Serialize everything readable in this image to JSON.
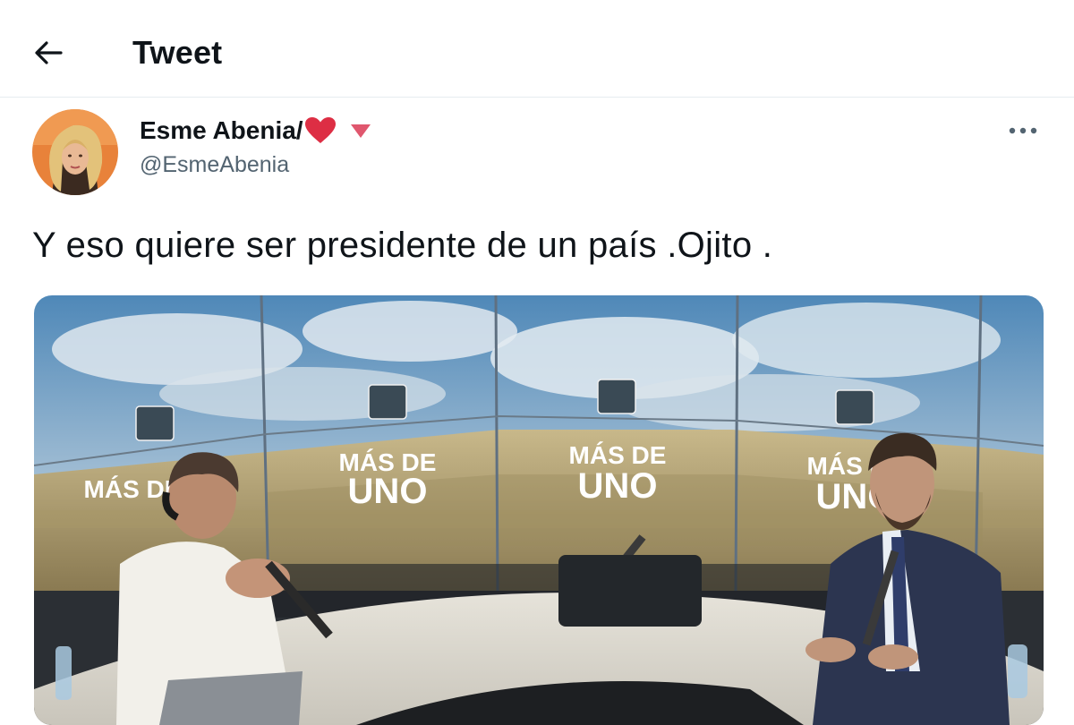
{
  "header": {
    "title": "Tweet",
    "back_icon": "back-arrow-icon"
  },
  "author": {
    "name": "Esme Abenia/",
    "handle": "@EsmeAbenia",
    "name_emoji": "heart-emoji",
    "badge_icon": "triangle-down-icon"
  },
  "tweet": {
    "text": "Y eso quiere ser presidente de un país .Ojito ."
  },
  "menu": {
    "more_icon": "more-dots-icon"
  },
  "media": {
    "overlay_text": "MÁS DE UNO",
    "line1": "MÁS DE",
    "line2": "UNO"
  },
  "colors": {
    "text": "#0f1419",
    "secondary": "#536471",
    "heart": "#e0245e",
    "border": "#e6ecf0"
  }
}
